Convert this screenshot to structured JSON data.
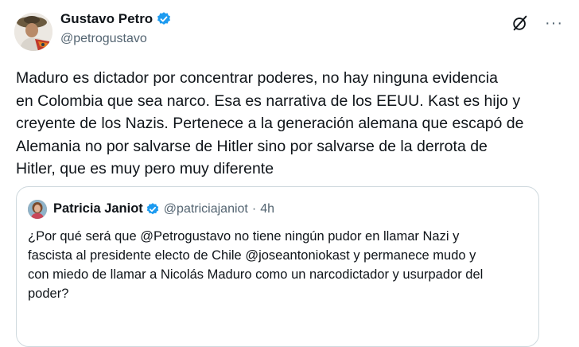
{
  "author": {
    "display_name": "Gustavo Petro",
    "handle": "@petrogustavo",
    "verified_color": "#1d9bf0"
  },
  "actions": {
    "grok_icon": "grok-slash-icon",
    "more_glyph": "···"
  },
  "tweet": {
    "lines": [
      "Maduro es dictador por concentrar poderes, no hay ninguna evidencia",
      "en Colombia que sea narco. Esa es narrativa de los EEUU. Kast es hijo y",
      "creyente de los Nazis. Pertenece a la generación alemana que escapó de",
      "Alemania no por salvarse de Hitler sino por salvarse de la derrota de",
      "Hitler, que es muy pero muy diferente"
    ]
  },
  "quoted": {
    "display_name": "Patricia Janiot",
    "handle": "@patriciajaniot",
    "separator": "·",
    "time": "4h",
    "lines": [
      "¿Por qué será que @Petrogustavo no tiene ningún pudor en llamar Nazi y",
      "fascista al presidente electo de Chile @joseantoniokast y permanece mudo y",
      "con miedo de llamar a Nicolás Maduro como un narcodictador y usurpador del",
      "poder?"
    ]
  },
  "colors": {
    "text": "#0f1419",
    "secondary": "#536471",
    "border": "#cfd9de",
    "verified": "#1d9bf0"
  }
}
